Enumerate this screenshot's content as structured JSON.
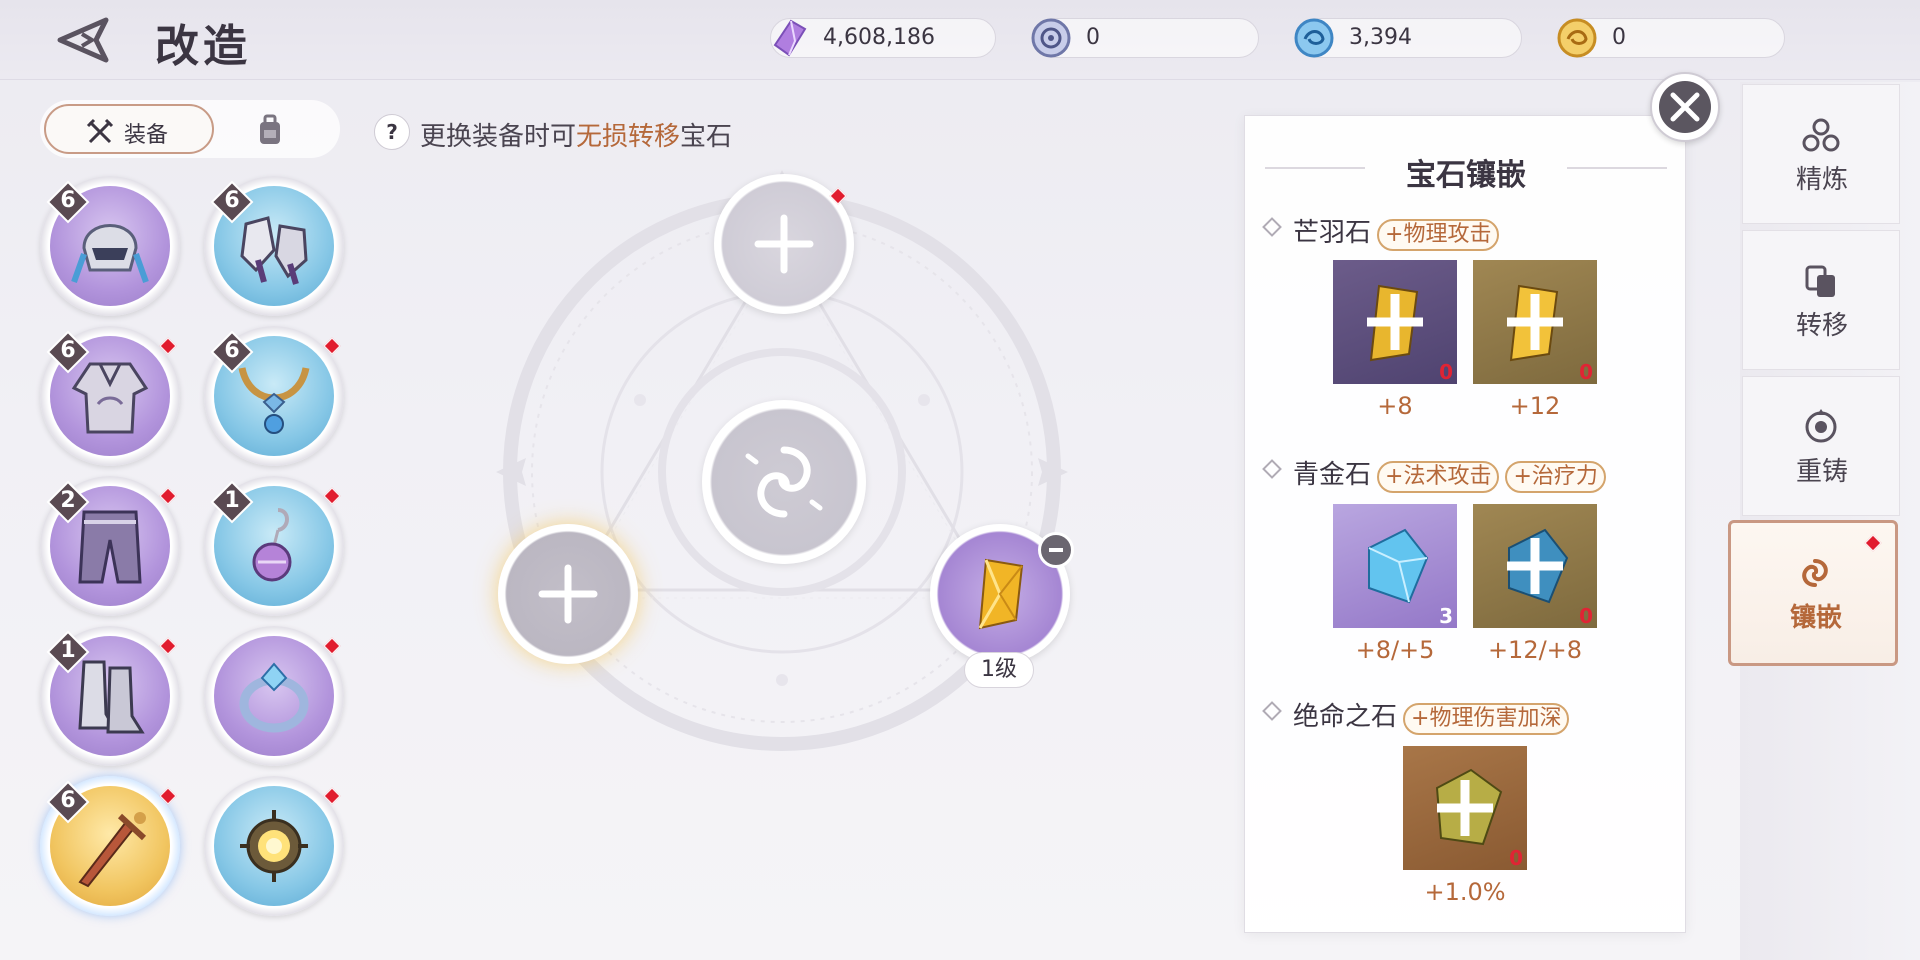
{
  "header": {
    "title": "改造",
    "currencies": [
      {
        "icon": "purple-crystal-icon",
        "value": "4,608,186"
      },
      {
        "icon": "silver-coin-icon",
        "value": "0"
      },
      {
        "icon": "blue-coin-icon",
        "value": "3,394"
      },
      {
        "icon": "gold-coin-icon",
        "value": "0"
      }
    ]
  },
  "left_panel": {
    "tabs": [
      {
        "label": "装备",
        "icon": "crossed-swords-icon",
        "active": true
      },
      {
        "label": "",
        "icon": "backpack-icon",
        "active": false
      }
    ],
    "slots": [
      {
        "item": "helmet",
        "level": "6",
        "color": "purple",
        "red_dot": false
      },
      {
        "item": "gauntlets",
        "level": "6",
        "color": "blue",
        "red_dot": false
      },
      {
        "item": "armor",
        "level": "6",
        "color": "purple",
        "red_dot": true
      },
      {
        "item": "necklace",
        "level": "6",
        "color": "blue",
        "red_dot": true
      },
      {
        "item": "pants",
        "level": "2",
        "color": "purple",
        "red_dot": true
      },
      {
        "item": "earring",
        "level": "1",
        "color": "blue",
        "red_dot": true
      },
      {
        "item": "boots",
        "level": "1",
        "color": "purple",
        "red_dot": true
      },
      {
        "item": "ring",
        "level": "",
        "color": "purple",
        "red_dot": true
      },
      {
        "item": "sword",
        "level": "6",
        "color": "gold",
        "red_dot": true,
        "selected": true
      },
      {
        "item": "amulet",
        "level": "",
        "color": "blue",
        "red_dot": true
      }
    ]
  },
  "hint": {
    "prefix": "更换装备时可",
    "highlight": "无损转移",
    "suffix": "宝石"
  },
  "sockets": {
    "filled_level": "1级"
  },
  "gem_panel": {
    "title": "宝石镶嵌",
    "groups": [
      {
        "name": "芒羽石",
        "tags": [
          "+物理攻击"
        ],
        "gems": [
          {
            "count": "0",
            "value": "+8",
            "bg": "purple"
          },
          {
            "count": "0",
            "value": "+12",
            "bg": "gold"
          }
        ]
      },
      {
        "name": "青金石",
        "tags": [
          "+法术攻击",
          "+治疗力"
        ],
        "gems": [
          {
            "count": "3",
            "value": "+8/+5",
            "bg": "lav"
          },
          {
            "count": "0",
            "value": "+12/+8",
            "bg": "gold"
          }
        ]
      },
      {
        "name": "绝命之石",
        "tags": [
          "+物理伤害加深"
        ],
        "gems": [
          {
            "count": "0",
            "value": "+1.0%",
            "bg": "orange"
          }
        ]
      }
    ]
  },
  "right_nav": [
    {
      "label": "精炼",
      "icon": "refine-icon",
      "active": false
    },
    {
      "label": "转移",
      "icon": "transfer-icon",
      "active": false
    },
    {
      "label": "重铸",
      "icon": "reforge-icon",
      "active": false
    },
    {
      "label": "镶嵌",
      "icon": "inlay-icon",
      "active": true,
      "red_dot": true
    }
  ],
  "colors": {
    "accent": "#b5683a",
    "red_dot": "#e11c2e",
    "panel_border": "#c99883"
  }
}
